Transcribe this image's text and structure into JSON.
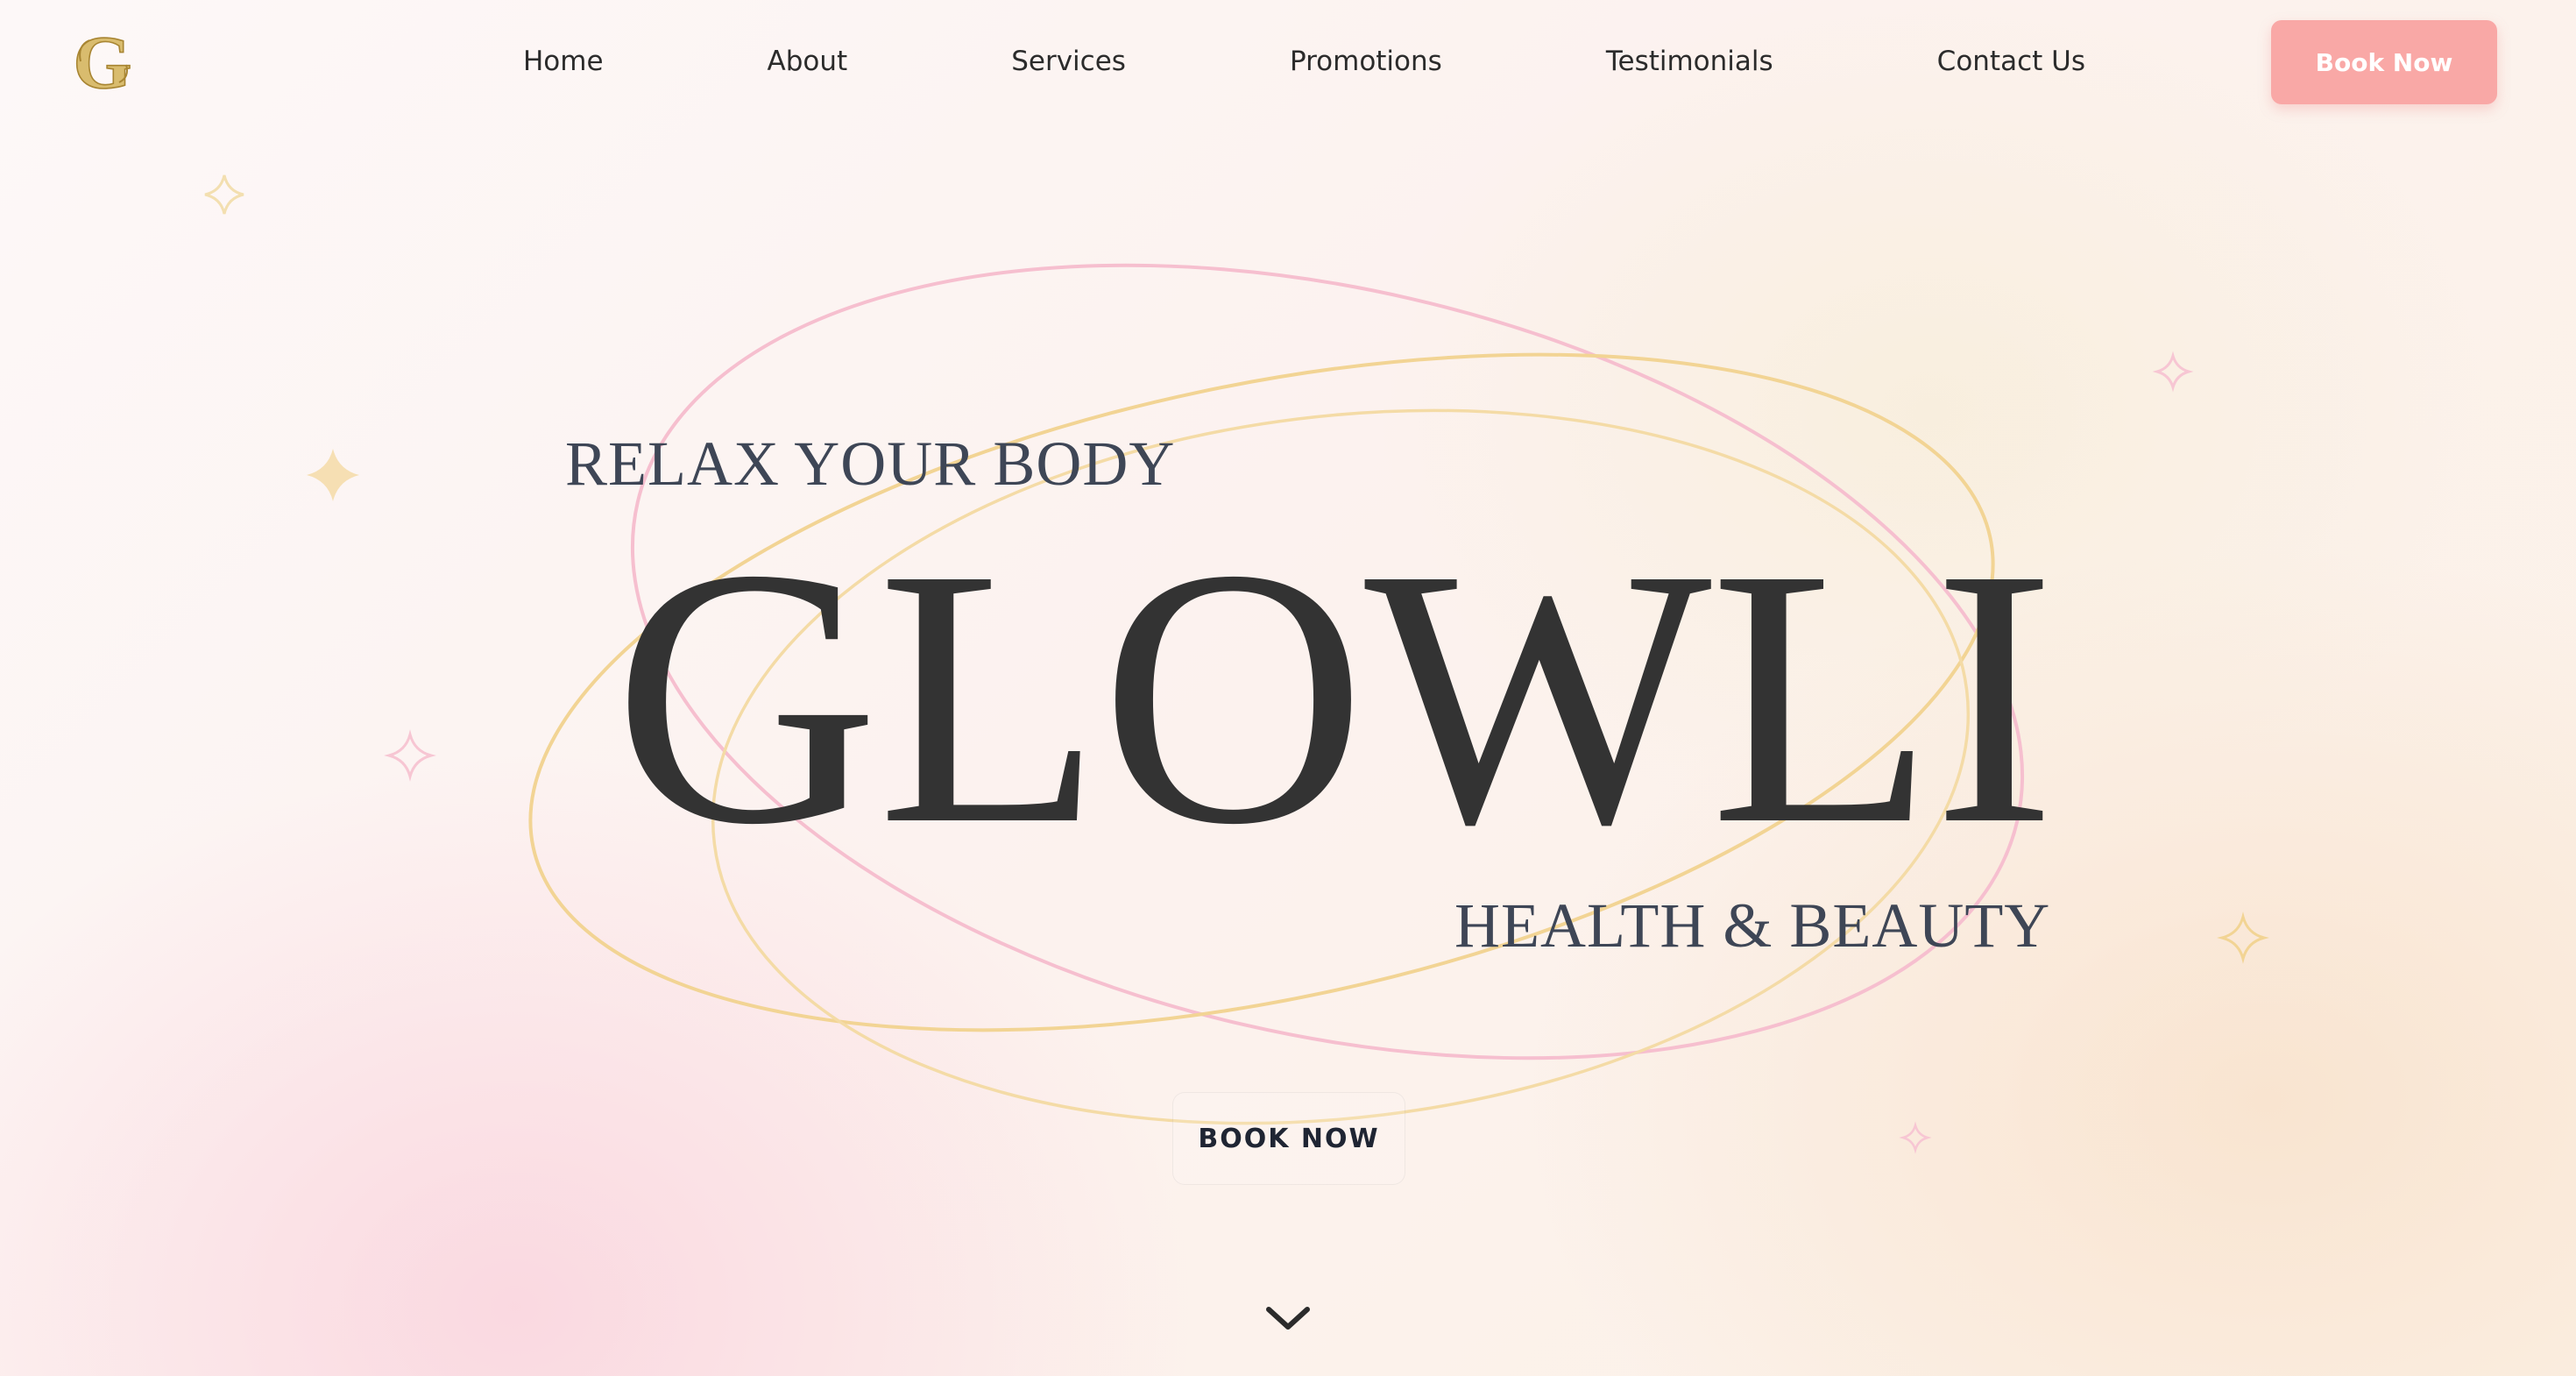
{
  "brand": {
    "logo_letter": "G",
    "logo_icon": "ornate-g-logo",
    "gold": "#c9a74f"
  },
  "nav": {
    "items": [
      {
        "label": "Home"
      },
      {
        "label": "About"
      },
      {
        "label": "Services"
      },
      {
        "label": "Promotions"
      },
      {
        "label": "Testimonials"
      },
      {
        "label": "Contact Us"
      }
    ],
    "cta_label": "Book Now",
    "cta_color": "#f9a8a6"
  },
  "hero": {
    "tagline_top": "RELAX YOUR BODY",
    "title": "GLOWLI",
    "tagline_bottom": "HEALTH & BEAUTY",
    "cta_label": "BOOK NOW",
    "scroll_icon": "chevron-down-icon",
    "ring_colors": {
      "pink": "#f6bfcf",
      "gold": "#f2d494"
    },
    "text_color": "#333333"
  }
}
